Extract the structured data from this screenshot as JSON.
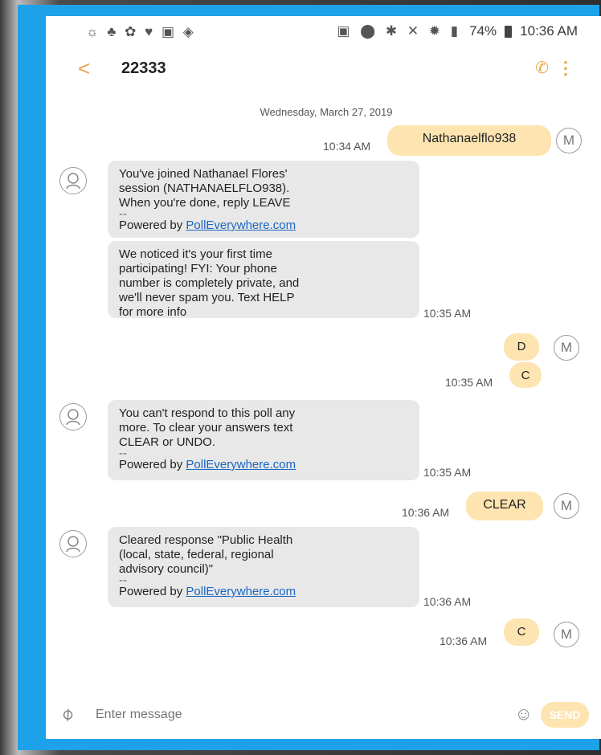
{
  "status_bar": {
    "left_icons": "☼ ♣ ✿ ♥ ▣ ◈",
    "right_icons": "▣ ⬤ ✱ ✕ ✹ ▮",
    "battery": "74%",
    "time": "10:36 AM"
  },
  "header": {
    "back_glyph": "<",
    "contact": "22333",
    "phone_glyph": "✆",
    "more_glyph": "⋮"
  },
  "date_divider": "Wednesday, March 27, 2019",
  "messages": [
    {
      "dir": "out",
      "text": "Nathanaelflo938",
      "time": "10:34 AM",
      "avatar": "M"
    },
    {
      "dir": "in",
      "lines": [
        "You've joined Nathanael Flores'",
        "session (NATHANAELFLO938).",
        "When you're done, reply LEAVE"
      ],
      "dash": "--",
      "powered_by": "Powered by",
      "link": "PollEverywhere.com"
    },
    {
      "dir": "in",
      "lines": [
        "We noticed it's your first time",
        "participating! FYI: Your phone",
        "number is completely private, and",
        "we'll never spam you. Text HELP",
        "for more info"
      ],
      "time": "10:35 AM"
    },
    {
      "dir": "out",
      "text": "D",
      "avatar": "M"
    },
    {
      "dir": "out",
      "text": "C",
      "time": "10:35 AM"
    },
    {
      "dir": "in",
      "lines": [
        "You can't respond to this poll any",
        "more. To clear your answers text",
        "CLEAR or UNDO."
      ],
      "dash": "--",
      "powered_by": "Powered by",
      "link": "PollEverywhere.com",
      "time": "10:35 AM"
    },
    {
      "dir": "out",
      "text": "CLEAR",
      "time": "10:36 AM",
      "avatar": "M"
    },
    {
      "dir": "in",
      "lines": [
        "Cleared response \"Public Health",
        "(local, state, federal, regional",
        "advisory council)\""
      ],
      "dash": "--",
      "powered_by": "Powered by",
      "link": "PollEverywhere.com",
      "time": "10:36 AM"
    },
    {
      "dir": "out",
      "text": "C",
      "time": "10:36 AM",
      "avatar": "M"
    }
  ],
  "compose": {
    "placeholder": "Enter message",
    "send_label": "SEND"
  },
  "colors": {
    "frame": "#1da1e8",
    "accent": "#e8a44a",
    "outgoing_bubble": "#fde4b0",
    "incoming_bubble": "#e8e8e8",
    "link": "#1a66c2"
  }
}
